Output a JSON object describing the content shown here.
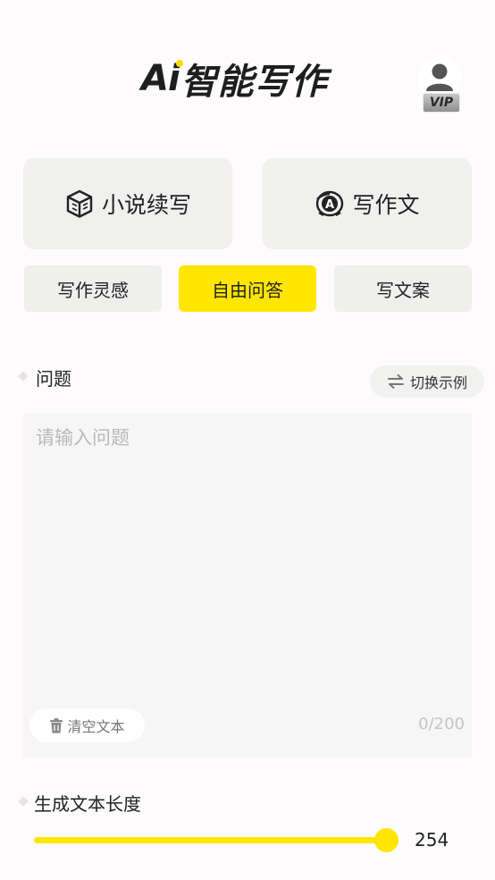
{
  "header": {
    "title_ai": "Ai",
    "title_rest": "智能写作",
    "vip_badge": "VIP"
  },
  "modes": [
    {
      "label": "小说续写",
      "icon": "cube-book-icon"
    },
    {
      "label": "写作文",
      "icon": "a-ring-icon"
    }
  ],
  "tabs": [
    {
      "label": "写作灵感",
      "active": false
    },
    {
      "label": "自由问答",
      "active": true
    },
    {
      "label": "写文案",
      "active": false
    }
  ],
  "question": {
    "label": "问题",
    "switch_example": "切换示例",
    "placeholder": "请输入问题",
    "clear_text": "清空文本",
    "counter": "0/200"
  },
  "length": {
    "label": "生成文本长度",
    "value": "254"
  },
  "colors": {
    "accent": "#ffe600",
    "card_bg": "#f0f0ef",
    "input_bg": "#f5f6f5"
  }
}
